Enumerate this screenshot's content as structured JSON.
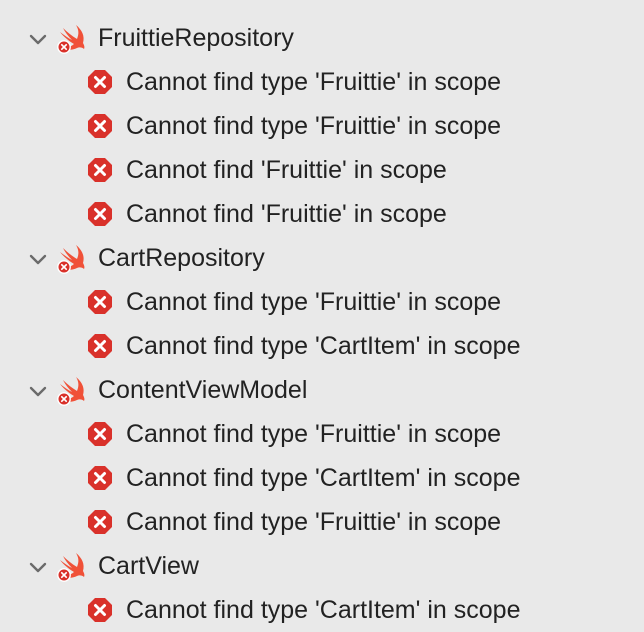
{
  "top_cut_text": "",
  "colors": {
    "background": "#e9e9e9",
    "swift_orange": "#f05138",
    "error_red": "#d9312a",
    "text": "#222222"
  },
  "groups": [
    {
      "file": "FruittieRepository",
      "icon": "swift-file-error-icon",
      "issues": [
        "Cannot find type 'Fruittie' in scope",
        "Cannot find type 'Fruittie' in scope",
        "Cannot find 'Fruittie' in scope",
        "Cannot find 'Fruittie' in scope"
      ]
    },
    {
      "file": "CartRepository",
      "icon": "swift-file-error-icon",
      "issues": [
        "Cannot find type 'Fruittie' in scope",
        "Cannot find type 'CartItem' in scope"
      ]
    },
    {
      "file": "ContentViewModel",
      "icon": "swift-file-error-icon",
      "issues": [
        "Cannot find type 'Fruittie' in scope",
        "Cannot find type 'CartItem' in scope",
        "Cannot find type 'Fruittie' in scope"
      ]
    },
    {
      "file": "CartView",
      "icon": "swift-file-error-icon",
      "issues": [
        "Cannot find type 'CartItem' in scope"
      ]
    }
  ]
}
